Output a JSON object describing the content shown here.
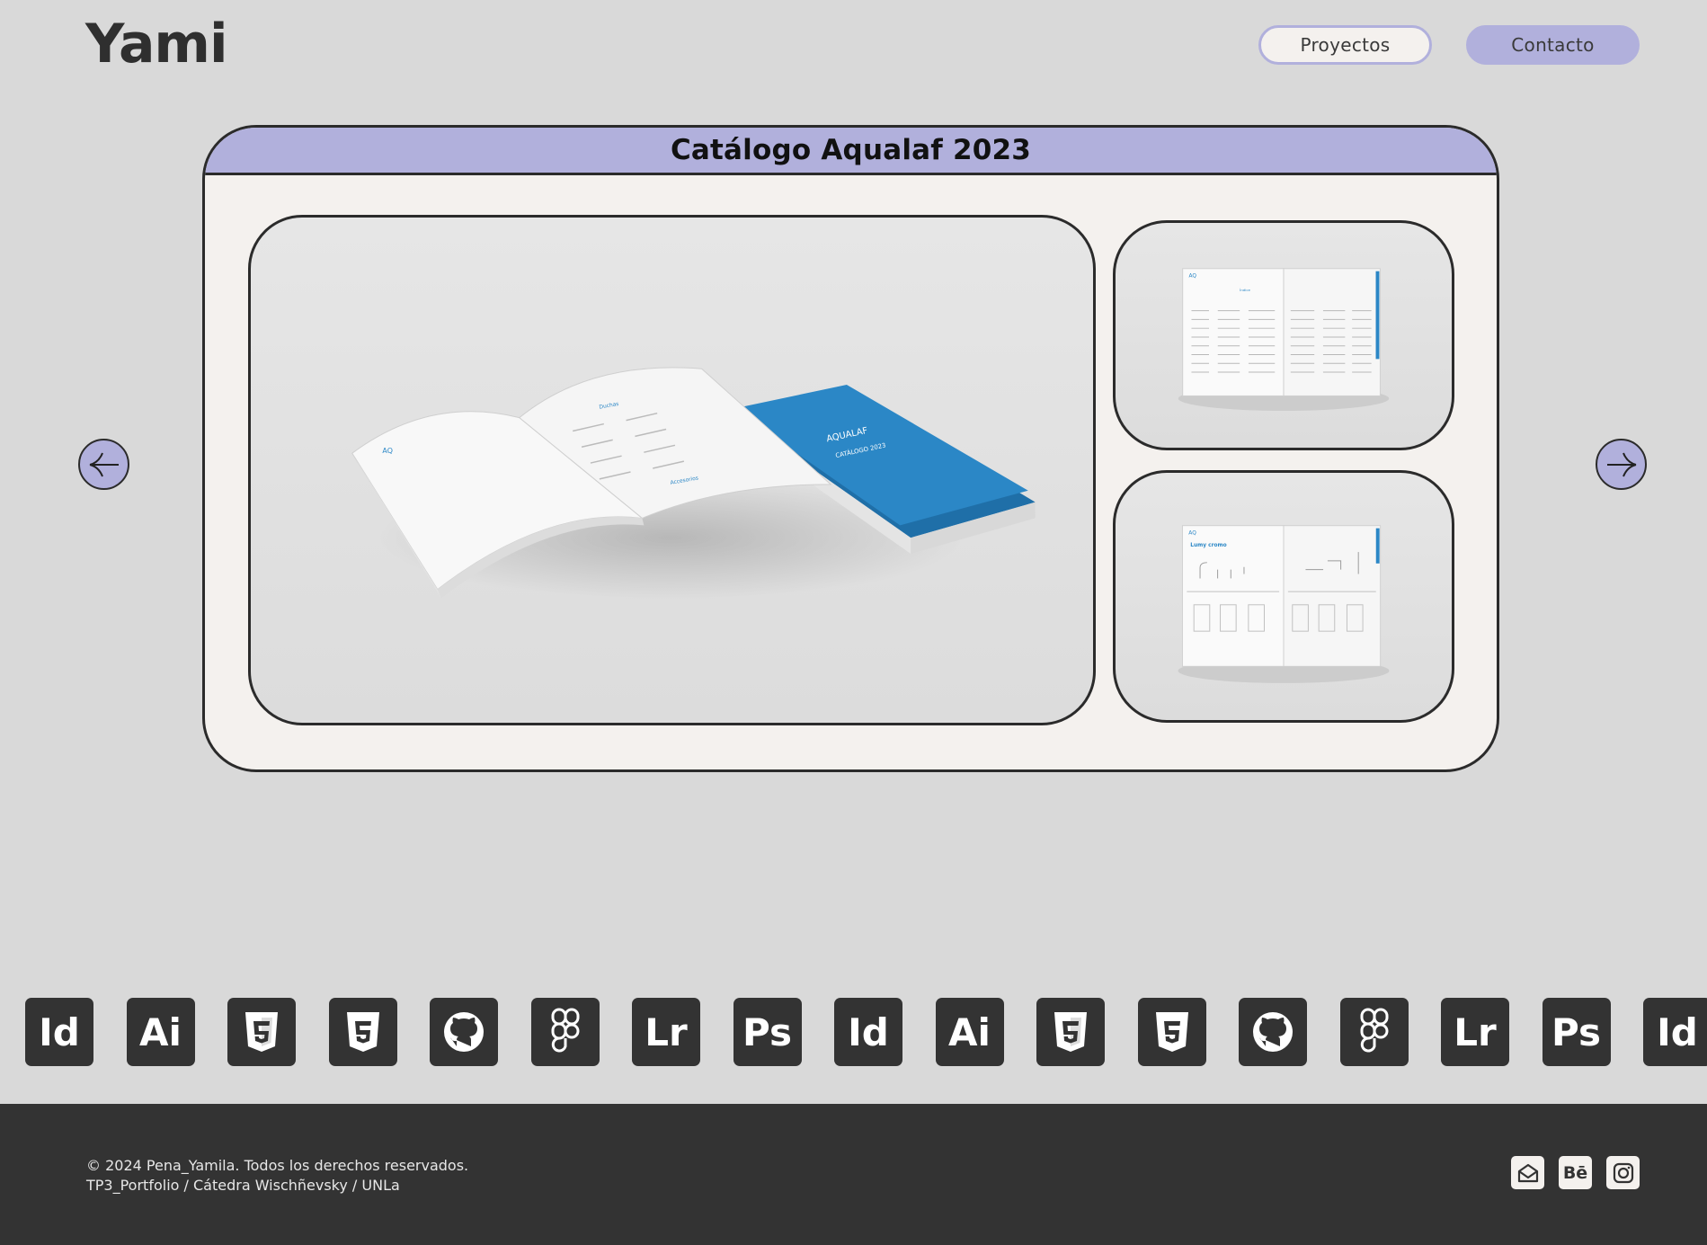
{
  "header": {
    "logo": "Yami",
    "nav": {
      "projects_label": "Proyectos",
      "contact_label": "Contacto"
    }
  },
  "project": {
    "title": "Catálogo Aqualaf 2023",
    "images": [
      "catalog-mockup-main",
      "catalog-spread-index",
      "catalog-spread-product"
    ],
    "prev_icon": "arrow-left-icon",
    "next_icon": "arrow-right-icon"
  },
  "tools": [
    {
      "icon": "indesign-icon",
      "label": "Id"
    },
    {
      "icon": "illustrator-icon",
      "label": "Ai"
    },
    {
      "icon": "html5-icon",
      "label": ""
    },
    {
      "icon": "css3-icon",
      "label": ""
    },
    {
      "icon": "github-icon",
      "label": ""
    },
    {
      "icon": "figma-icon",
      "label": ""
    },
    {
      "icon": "lightroom-icon",
      "label": "Lr"
    },
    {
      "icon": "photoshop-icon",
      "label": "Ps"
    },
    {
      "icon": "indesign-icon",
      "label": "Id"
    },
    {
      "icon": "illustrator-icon",
      "label": "Ai"
    },
    {
      "icon": "html5-icon",
      "label": ""
    },
    {
      "icon": "css3-icon",
      "label": ""
    },
    {
      "icon": "github-icon",
      "label": ""
    },
    {
      "icon": "figma-icon",
      "label": ""
    },
    {
      "icon": "lightroom-icon",
      "label": "Lr"
    },
    {
      "icon": "photoshop-icon",
      "label": "Ps"
    },
    {
      "icon": "indesign-icon",
      "label": "Id"
    }
  ],
  "footer": {
    "copyright": "© 2024 Pena_Yamila. Todos los derechos reservados.",
    "credits": "TP3_Portfolio / Cátedra Wischñevsky / UNLa",
    "social": [
      {
        "icon": "email-icon"
      },
      {
        "icon": "behance-icon",
        "label": "Bē"
      },
      {
        "icon": "instagram-icon"
      }
    ]
  },
  "colors": {
    "background": "#d9d9d9",
    "accent": "#b1b0dc",
    "card": "#f4f1ee",
    "dark": "#333333",
    "catalog_blue": "#2b87c6"
  }
}
